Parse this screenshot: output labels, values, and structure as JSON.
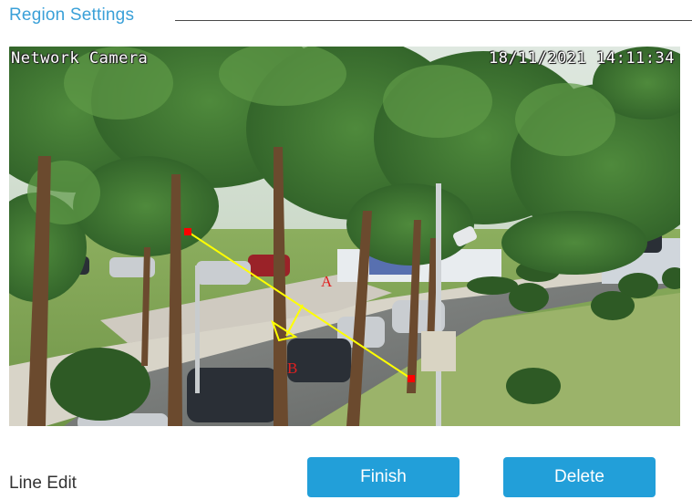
{
  "section": {
    "title": "Region Settings"
  },
  "camera": {
    "osd_name": "Network Camera",
    "osd_timestamp": "18/11/2021  14:11:34"
  },
  "line": {
    "endpoint_label_a": "A",
    "endpoint_label_b": "B",
    "color": "#ffff00",
    "handle_color": "#ff0000"
  },
  "footer": {
    "mode_label": "Line Edit",
    "finish_label": "Finish",
    "delete_label": "Delete"
  },
  "colors": {
    "accent": "#229fd9",
    "title": "#3aa0d8"
  }
}
